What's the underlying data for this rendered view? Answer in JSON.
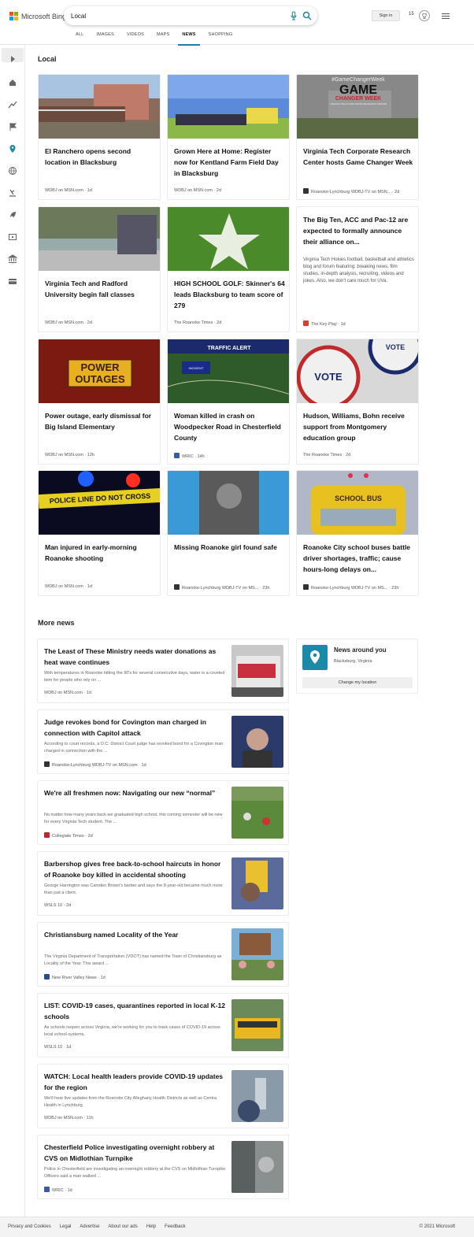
{
  "header": {
    "brand": "Microsoft Bing",
    "search_value": "Local",
    "signin_label": "Sign in",
    "points": "15",
    "tabs": [
      {
        "label": "ALL",
        "active": false
      },
      {
        "label": "IMAGES",
        "active": false
      },
      {
        "label": "VIDEOS",
        "active": false
      },
      {
        "label": "MAPS",
        "active": false
      },
      {
        "label": "NEWS",
        "active": true
      },
      {
        "label": "SHOPPING",
        "active": false
      }
    ]
  },
  "rail": {
    "icons": [
      "expand-icon",
      "home-icon",
      "trending-icon",
      "flag-icon",
      "location-icon",
      "globe-icon",
      "science-icon",
      "rocket-icon",
      "video-icon",
      "bank-icon",
      "card-icon"
    ]
  },
  "local": {
    "title": "Local",
    "cards": [
      {
        "title": "El Ranchero opens second location in Blacksburg",
        "source": "WDBJ on MSN.com",
        "time": "1d",
        "favicon": null
      },
      {
        "title": "Grown Here at Home: Register now for Kentland Farm Field Day in Blacksburg",
        "source": "WDBJ on MSN.com",
        "time": "2d",
        "favicon": null
      },
      {
        "title": "Virginia Tech Corporate Research Center hosts Game Changer Week",
        "source": "Roanoke-Lynchburg WDBJ-TV on MSN...",
        "time": "2d",
        "favicon": "#333333"
      },
      {
        "title": "Virginia Tech and Radford University begin fall classes",
        "source": "WDBJ on MSN.com",
        "time": "2d",
        "favicon": null
      },
      {
        "title": "HIGH SCHOOL GOLF: Skinner's 64 leads Blacksburg to team score of 279",
        "source": "The Roanoke Times",
        "time": "2d",
        "favicon": null
      },
      {
        "title": "The Big Ten, ACC and Pac-12 are expected to formally announce their alliance on...",
        "snippet": "Virginia Tech Hokies football, basketball and athletics blog and forum featuring: breaking news, film studies, in-depth analysis, recruiting, videos and jokes. Also, we don't care much for UVa.",
        "source": "The Key Play",
        "time": "1d",
        "favicon": "#d8402a"
      },
      {
        "title": "Power outage, early dismissal for Big Island Elementary",
        "source": "WDBJ on MSN.com",
        "time": "12h",
        "favicon": null
      },
      {
        "title": "Woman killed in crash on Woodpecker Road in Chesterfield County",
        "source": "WRIC",
        "time": "14h",
        "favicon": "#3a5aa8"
      },
      {
        "title": "Hudson, Williams, Bohn receive support from Montgomery education group",
        "source": "The Roanoke Times",
        "time": "2d",
        "favicon": null
      },
      {
        "title": "Man injured in early-morning Roanoke shooting",
        "source": "WDBJ on MSN.com",
        "time": "1d",
        "favicon": null
      },
      {
        "title": "Missing Roanoke girl found safe",
        "source": "Roanoke-Lynchburg WDBJ-TV on MS...",
        "time": "23h",
        "favicon": "#333333"
      },
      {
        "title": "Roanoke City school buses battle driver shortages, traffic; cause hours-long delays on...",
        "source": "Roanoke-Lynchburg WDBJ-TV on MS...",
        "time": "23h",
        "favicon": "#333333"
      }
    ],
    "image_text": {
      "game_tag": "#GameChangerWeek",
      "game_big": "GAME",
      "game_sub": "CHANGER WEEK",
      "game_small": "VIRGINIA TECH CORPORATE RESEARCH CENTER",
      "power": "POWER",
      "outages": "OUTAGES",
      "traffic_alert": "TRAFFIC ALERT",
      "incident": "INCIDENT",
      "vote": "VOTE",
      "police_tape": "POLICE LINE DO NOT CROSS",
      "school_bus": "SCHOOL BUS"
    }
  },
  "more_news": {
    "title": "More news",
    "items": [
      {
        "title": "The Least of These Ministry needs water donations as heat wave continues",
        "desc": "With temperatures in Roanoke hitting the 90's for several consecutive days, water is a coveted item for people who rely on ...",
        "source": "WDBJ on MSN.com",
        "time": "1d",
        "favicon": null
      },
      {
        "title": "Judge revokes bond for Covington man charged in connection with Capitol attack",
        "desc": "According to court records, a D.C. District Court judge has revoked bond for a Covington man charged in connection with the ...",
        "source": "Roanoke-Lynchburg WDBJ-TV on MSN.com",
        "time": "1d",
        "favicon": "#333333"
      },
      {
        "title": "We're all freshmen now: Navigating our new “normal”",
        "desc": "No matter how many years back we graduated high school, this coming semester will be new for every Virginia Tech student. The ...",
        "source": "Collegiate Times",
        "time": "2d",
        "favicon": "#c0262d"
      },
      {
        "title": "Barbershop gives free back-to-school haircuts in honor of Roanoke boy killed in accidental shooting",
        "desc": "George Harrington was Camden Brown's barber and says the 8-year-old became much more than just a client.",
        "source": "WSLS 10",
        "time": "2d",
        "favicon": null
      },
      {
        "title": "Christiansburg named Locality of the Year",
        "desc": "The Virginia Department of Transportation (VDOT) has named the Town of Christiansburg as Locality of the Year. This award ...",
        "source": "New River Valley News",
        "time": "1d",
        "favicon": "#2b4c8c"
      },
      {
        "title": "LIST: COVID-19 cases, quarantines reported in local K-12 schools",
        "desc": "As schools reopen across Virginia, we're working for you to track cases of COVID-19 across local school systems.",
        "source": "WSLS 10",
        "time": "1d",
        "favicon": null
      },
      {
        "title": "WATCH: Local health leaders provide COVID-19 updates for the region",
        "desc": "We'll hear live updates from the Roanoke City Alleghany Health Districts as well as Centra Health in Lynchburg.",
        "source": "WDBJ on MSN.com",
        "time": "11h",
        "favicon": null
      },
      {
        "title": "Chesterfield Police investigating overnight robbery at CVS on Midlothian Turnpike",
        "desc": "Police in Chesterfield are investigating an overnight robbery at the CVS on Midlothian Turnpike. Officers said a man walked ...",
        "source": "WRIC",
        "time": "1d",
        "favicon": "#3a5aa8"
      }
    ]
  },
  "news_around": {
    "title": "News around you",
    "location": "Blacksburg, Virginia",
    "button": "Change my location"
  },
  "footer": {
    "links": [
      "Privacy and Cookies",
      "Legal",
      "Advertise",
      "About our ads",
      "Help",
      "Feedback"
    ],
    "copyright": "© 2021 Microsoft"
  },
  "colors": {
    "accent": "#1a7fa0",
    "pin": "#1b8aa8"
  }
}
